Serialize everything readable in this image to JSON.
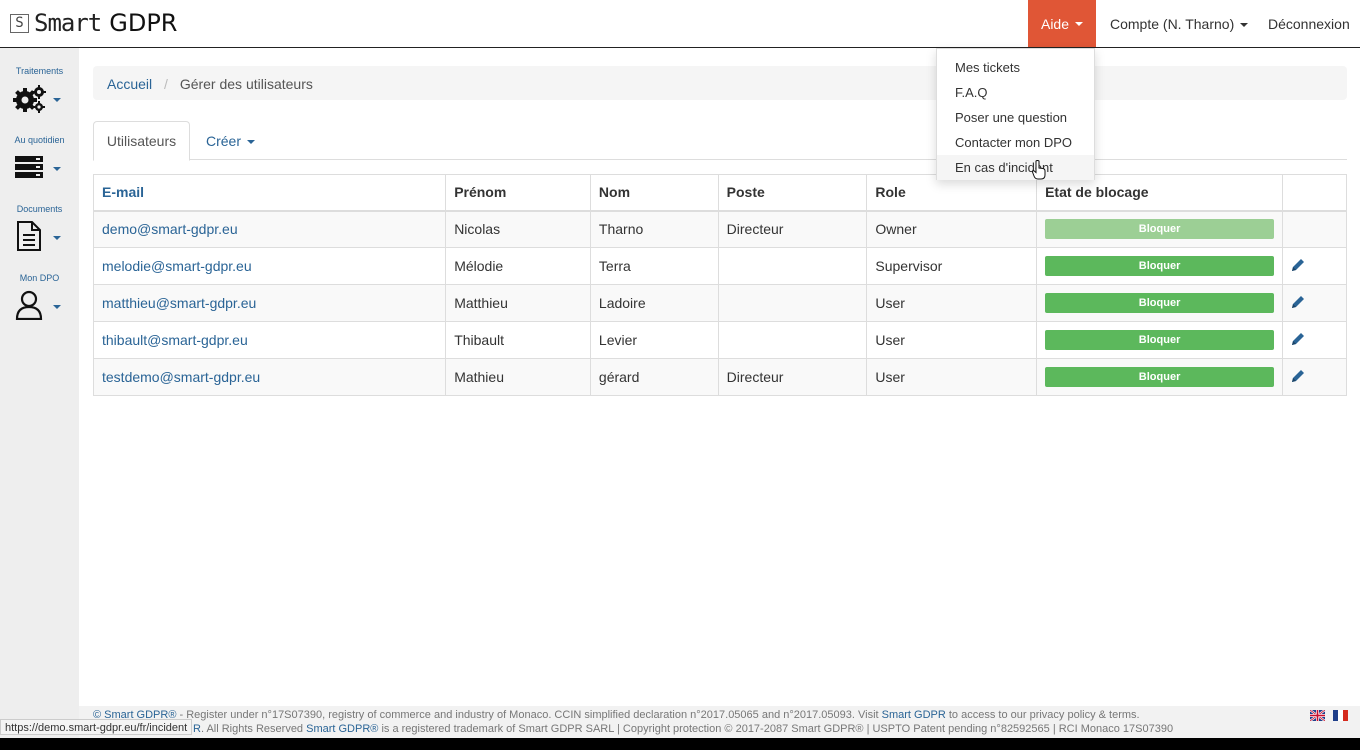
{
  "brand": {
    "prefix": "S",
    "smart": "Smart",
    "gdpr": "GDPR"
  },
  "navbar": {
    "aide": "Aide",
    "compte": "Compte (N. Tharno)",
    "logout": "Déconnexion",
    "accent": "#e05636"
  },
  "sidebar": [
    {
      "label": "Traitements",
      "icon": "gears-icon"
    },
    {
      "label": "Au quotidien",
      "icon": "server-icon"
    },
    {
      "label": "Documents",
      "icon": "document-icon"
    },
    {
      "label": "Mon DPO",
      "icon": "user-icon"
    }
  ],
  "breadcrumb": {
    "home": "Accueil",
    "separator": "/",
    "current": "Gérer des utilisateurs"
  },
  "tabs": {
    "users": "Utilisateurs",
    "create": "Créer"
  },
  "table": {
    "headers": [
      "E-mail",
      "Prénom",
      "Nom",
      "Poste",
      "Role",
      "Etat de blocage",
      ""
    ],
    "rows": [
      {
        "email": "demo@smart-gdpr.eu",
        "prenom": "Nicolas",
        "nom": "Tharno",
        "poste": "Directeur",
        "role": "Owner",
        "action": "Bloquer",
        "editable": false
      },
      {
        "email": "melodie@smart-gdpr.eu",
        "prenom": "Mélodie",
        "nom": "Terra",
        "poste": "",
        "role": "Supervisor",
        "action": "Bloquer",
        "editable": true
      },
      {
        "email": "matthieu@smart-gdpr.eu",
        "prenom": "Matthieu",
        "nom": "Ladoire",
        "poste": "",
        "role": "User",
        "action": "Bloquer",
        "editable": true
      },
      {
        "email": "thibault@smart-gdpr.eu",
        "prenom": "Thibault",
        "nom": "Levier",
        "poste": "",
        "role": "User",
        "action": "Bloquer",
        "editable": true
      },
      {
        "email": "testdemo@smart-gdpr.eu",
        "prenom": "Mathieu",
        "nom": "gérard",
        "poste": "Directeur",
        "role": "User",
        "action": "Bloquer",
        "editable": true
      }
    ],
    "button_color": "#5cb85c"
  },
  "dropdown": {
    "items": [
      "Mes tickets",
      "F.A.Q",
      "Poser une question",
      "Contacter mon DPO",
      "En cas d'incident"
    ],
    "hovered": 4
  },
  "footer": {
    "line1_brand": "© Smart GDPR®",
    "line1_text": " - Register under n°17S07390, registry of commerce and industry of Monaco. CCIN simplified declaration n°2017.05065 and n°2017.05093. Visit ",
    "line1_link": "Smart GDPR",
    "line1_end": " to access to our privacy policy & terms.",
    "line2_start": "R",
    "line2_text": ". All Rights Reserved ",
    "line2_brand": "Smart GDPR®",
    "line2_end": " is a registered trademark of Smart GDPR SARL | Copyright protection © 2017-2087 Smart GDPR® | USPTO Patent pending n°82592565 | RCI Monaco 17S07390"
  },
  "status_url": "https://demo.smart-gdpr.eu/fr/incident"
}
